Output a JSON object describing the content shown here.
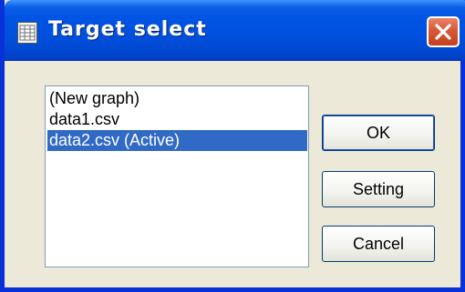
{
  "window": {
    "title": "Target select",
    "close_label": "Close",
    "title_icon": "grid-window-icon",
    "close_icon": "close-x-icon"
  },
  "target_list": {
    "items": [
      {
        "label": "(New graph)",
        "selected": false
      },
      {
        "label": "data1.csv",
        "selected": false
      },
      {
        "label": "data2.csv (Active)",
        "selected": true
      }
    ]
  },
  "buttons": {
    "ok": "OK",
    "setting": "Setting",
    "cancel": "Cancel"
  },
  "colors": {
    "titlebar": "#0054e3",
    "selection": "#316ac5",
    "close_button": "#d95b3a",
    "dialog_face": "#ece9d8"
  }
}
